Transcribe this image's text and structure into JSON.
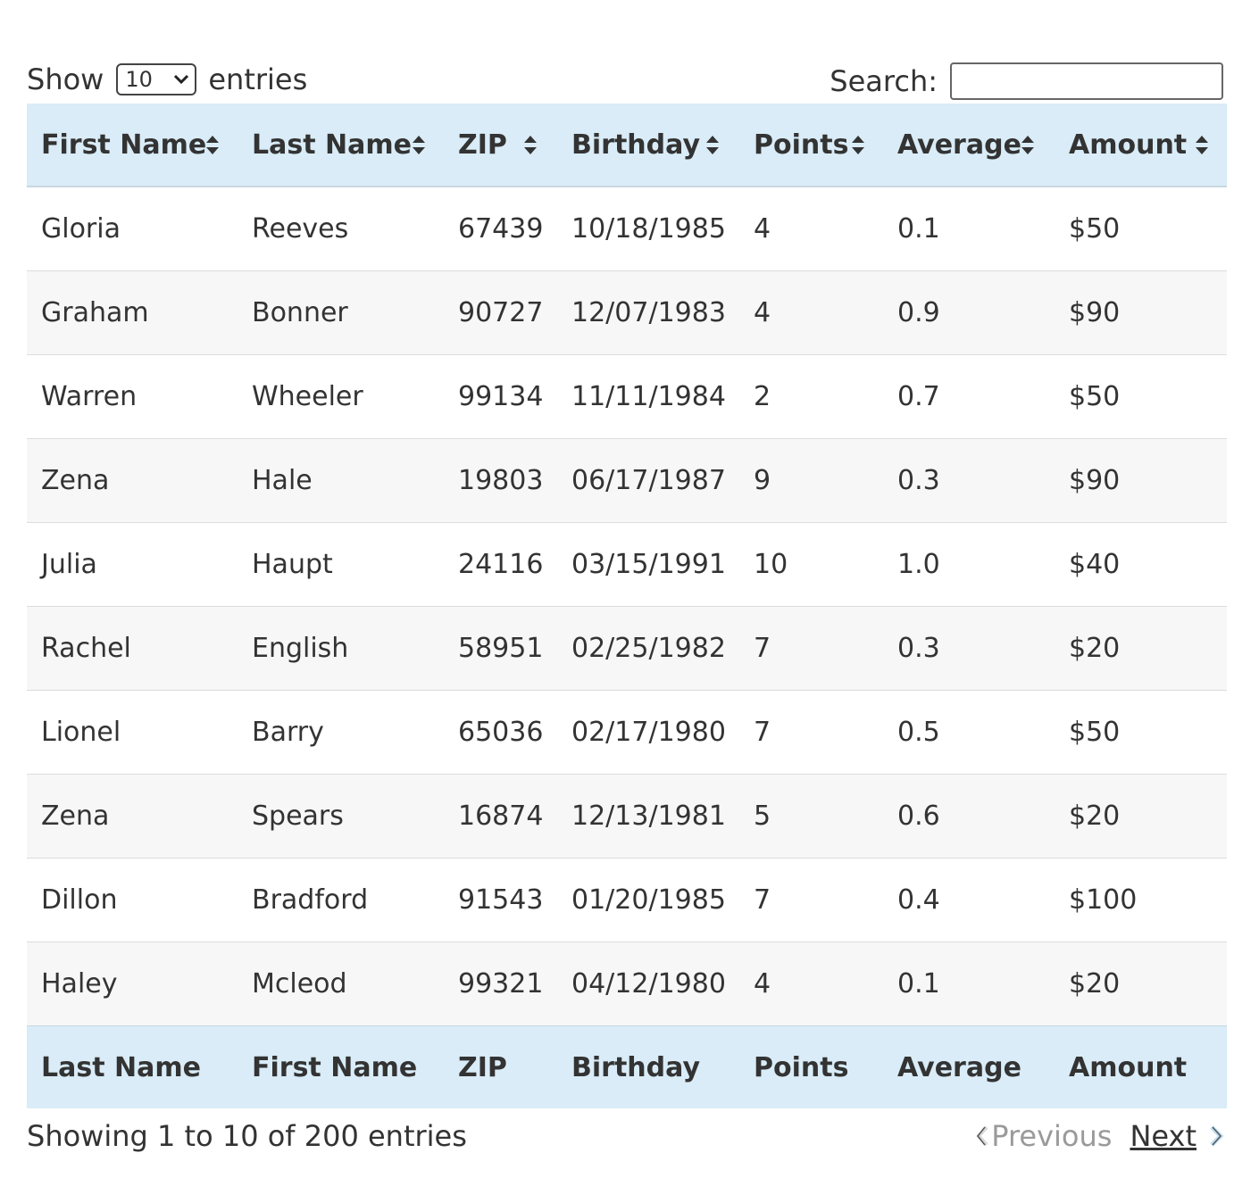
{
  "length_control": {
    "show_label": "Show",
    "selected": "10",
    "entries_label": "entries"
  },
  "search": {
    "label": "Search:",
    "value": ""
  },
  "table": {
    "header": [
      "First Name",
      "Last Name",
      "ZIP",
      "Birthday",
      "Points",
      "Average",
      "Amount"
    ],
    "footer": [
      "Last Name",
      "First Name",
      "ZIP",
      "Birthday",
      "Points",
      "Average",
      "Amount"
    ],
    "rows": [
      [
        "Gloria",
        "Reeves",
        "67439",
        "10/18/1985",
        "4",
        "0.1",
        "$50"
      ],
      [
        "Graham",
        "Bonner",
        "90727",
        "12/07/1983",
        "4",
        "0.9",
        "$90"
      ],
      [
        "Warren",
        "Wheeler",
        "99134",
        "11/11/1984",
        "2",
        "0.7",
        "$50"
      ],
      [
        "Zena",
        "Hale",
        "19803",
        "06/17/1987",
        "9",
        "0.3",
        "$90"
      ],
      [
        "Julia",
        "Haupt",
        "24116",
        "03/15/1991",
        "10",
        "1.0",
        "$40"
      ],
      [
        "Rachel",
        "English",
        "58951",
        "02/25/1982",
        "7",
        "0.3",
        "$20"
      ],
      [
        "Lionel",
        "Barry",
        "65036",
        "02/17/1980",
        "7",
        "0.5",
        "$50"
      ],
      [
        "Zena",
        "Spears",
        "16874",
        "12/13/1981",
        "5",
        "0.6",
        "$20"
      ],
      [
        "Dillon",
        "Bradford",
        "91543",
        "01/20/1985",
        "7",
        "0.4",
        "$100"
      ],
      [
        "Haley",
        "Mcleod",
        "99321",
        "04/12/1980",
        "4",
        "0.1",
        "$20"
      ]
    ]
  },
  "info": {
    "text": "Showing 1 to 10 of 200 entries"
  },
  "pagination": {
    "previous": "Previous",
    "next": "Next"
  }
}
